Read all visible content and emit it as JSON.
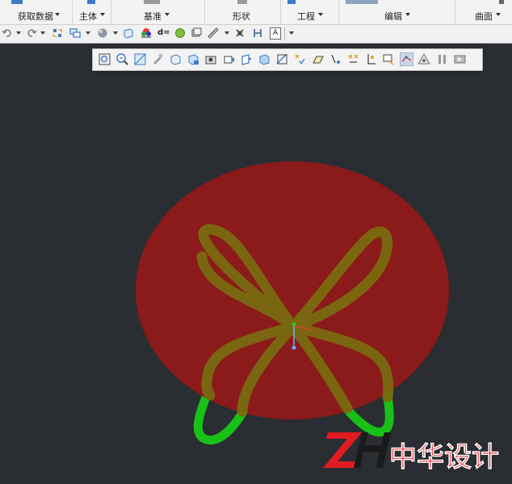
{
  "ribbon": {
    "groups": [
      {
        "label": "获取数据",
        "dropdown": true
      },
      {
        "label": "主体",
        "dropdown": true
      },
      {
        "label": "基准",
        "dropdown": true
      },
      {
        "label": "形状",
        "dropdown": false
      },
      {
        "label": "工程",
        "dropdown": true
      },
      {
        "label": "编辑",
        "dropdown": true
      },
      {
        "label": "曲面",
        "dropdown": true
      }
    ]
  },
  "quick_access": {
    "items": [
      "undo-icon",
      "redo-icon",
      "regenerate-icon",
      "windows-icon",
      "appearance-sphere-icon",
      "plane-display-icon",
      "appearance-gallery-icon",
      "dimension-d-icon",
      "display-style-icon",
      "saved-views-icon",
      "measure-icon",
      "close-window-icon",
      "save-icon",
      "annotation-icon",
      "customize-icon"
    ],
    "annotation_letter": "A",
    "dimension_text": "d="
  },
  "view_toolbar": {
    "items": [
      "refit-icon",
      "zoom-in-icon",
      "zoom-out-icon",
      "repaint-icon",
      "shading-icon",
      "saved-orientation-icon",
      "display-style-icon",
      "view-manager-icon",
      "plane-display-icon",
      "axis-display-icon",
      "point-display-icon",
      "csys-display-icon",
      "annotation-display-icon",
      "spin-center-icon",
      "datum-display-filter-icon",
      "sketch-display-icon",
      "point-tags-icon",
      "csys-tags-icon",
      "annotation-tags-icon",
      "hidden-line-icon",
      "active-sketch-icon",
      "model-tree-icon",
      "pause-icon",
      "next-icon"
    ]
  },
  "scene": {
    "colors": {
      "background": "#2a2d31",
      "disc": "#8b1a1a",
      "tube_front": "#7a6a10",
      "tube_exposed": "#18c018",
      "axis": "#2a9d2a",
      "origin_marker": "#6ea8ff"
    }
  },
  "watermark": {
    "brand": "中华设计",
    "logo_letters": "ZH"
  }
}
